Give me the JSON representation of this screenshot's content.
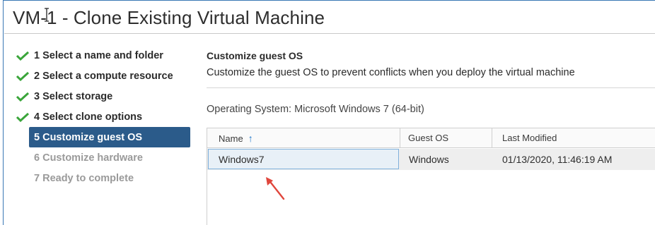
{
  "window": {
    "title": "VM-1 - Clone Existing Virtual Machine"
  },
  "steps": [
    {
      "label": "1 Select a name and folder",
      "state": "completed"
    },
    {
      "label": "2 Select a compute resource",
      "state": "completed"
    },
    {
      "label": "3 Select storage",
      "state": "completed"
    },
    {
      "label": "4 Select clone options",
      "state": "completed"
    },
    {
      "label": "5 Customize guest OS",
      "state": "active"
    },
    {
      "label": "6 Customize hardware",
      "state": "pending"
    },
    {
      "label": "7 Ready to complete",
      "state": "pending"
    }
  ],
  "section": {
    "title": "Customize guest OS",
    "description": "Customize the guest OS to prevent conflicts when you deploy the virtual machine",
    "operating_system": "Operating System: Microsoft Windows 7 (64-bit)"
  },
  "table": {
    "columns": [
      "Name",
      "Guest OS",
      "Last Modified"
    ],
    "sort_icon": "arrow-up-icon",
    "rows": [
      {
        "name": "Windows7",
        "guest_os": "Windows",
        "last_modified": "01/13/2020, 11:46:19 AM"
      }
    ]
  },
  "colors": {
    "active_step_bg": "#2b5b8a",
    "check_green": "#3aa53a",
    "annotation_red": "#e0463c",
    "sort_arrow": "#1a73c8"
  }
}
